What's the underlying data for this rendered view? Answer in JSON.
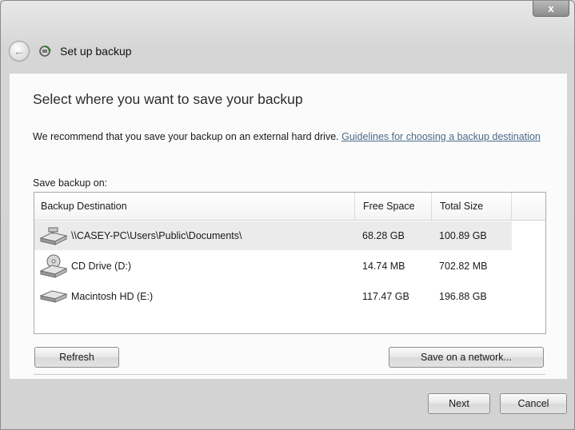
{
  "window": {
    "close_glyph": "x",
    "title": "Set up backup"
  },
  "content": {
    "heading": "Select where you want to save your backup",
    "recommend_text": "We recommend that you save your backup on an external hard drive. ",
    "recommend_link": "Guidelines for choosing a backup destination",
    "save_label": "Save backup on:"
  },
  "table": {
    "headers": {
      "destination": "Backup Destination",
      "free": "Free Space",
      "total": "Total Size"
    },
    "rows": [
      {
        "name": "\\\\CASEY-PC\\Users\\Public\\Documents\\",
        "free": "68.28 GB",
        "total": "100.89 GB",
        "icon": "network-drive-icon",
        "selected": true
      },
      {
        "name": "CD Drive (D:)",
        "free": "14.74 MB",
        "total": "702.82 MB",
        "icon": "cd-drive-icon",
        "selected": false
      },
      {
        "name": "Macintosh HD (E:)",
        "free": "117.47 GB",
        "total": "196.88 GB",
        "icon": "hard-drive-icon",
        "selected": false
      }
    ]
  },
  "buttons": {
    "refresh": "Refresh",
    "save_network": "Save on a network...",
    "next": "Next",
    "cancel": "Cancel"
  }
}
